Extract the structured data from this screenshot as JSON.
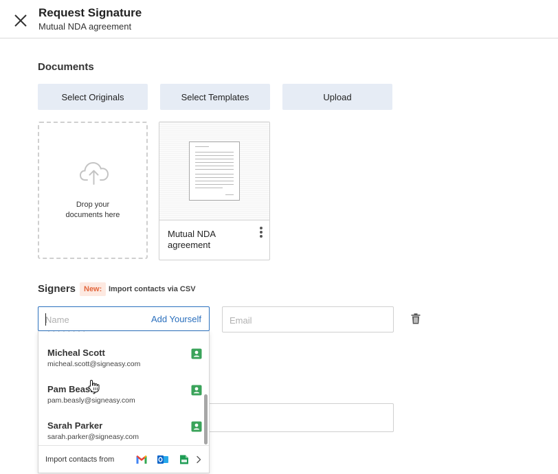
{
  "header": {
    "title": "Request Signature",
    "subtitle": "Mutual NDA agreement",
    "close_icon": "close-icon"
  },
  "documents": {
    "section_title": "Documents",
    "buttons": [
      "Select Originals",
      "Select Templates",
      "Upload"
    ],
    "dropzone": {
      "icon": "cloud-upload-icon",
      "line1": "Drop your",
      "line2": "documents here"
    },
    "files": [
      {
        "name_line1": "Mutual NDA",
        "name_line2": "agreement",
        "menu_icon": "kebab-menu-icon"
      }
    ]
  },
  "signers": {
    "section_title": "Signers",
    "new_badge": "New:",
    "csv_link": "Import contacts via CSV",
    "name_placeholder": "Name",
    "add_yourself": "Add Yourself",
    "email_placeholder": "Email",
    "delete_icon": "trash-icon"
  },
  "suggestions": {
    "contacts": [
      {
        "name": "Micheal Scott",
        "email": "micheal.scott@signeasy.com",
        "icon": "contact-card-icon"
      },
      {
        "name": "Pam Beasly",
        "email": "pam.beasly@signeasy.com",
        "icon": "contact-card-icon"
      },
      {
        "name": "Sarah Parker",
        "email": "sarah.parker@signeasy.com",
        "icon": "contact-card-icon"
      }
    ],
    "import_label": "Import contacts from",
    "import_sources": [
      "gmail-icon",
      "outlook-icon",
      "csv-file-icon"
    ],
    "more_icon": "chevron-right-icon",
    "scroll_position": 0.72
  },
  "colors": {
    "accent": "#2a6fbd",
    "button_bg": "#e6ecf5",
    "badge_bg": "#fde9e1",
    "badge_text": "#e2663d",
    "contact_icon": "#3aa35a"
  }
}
